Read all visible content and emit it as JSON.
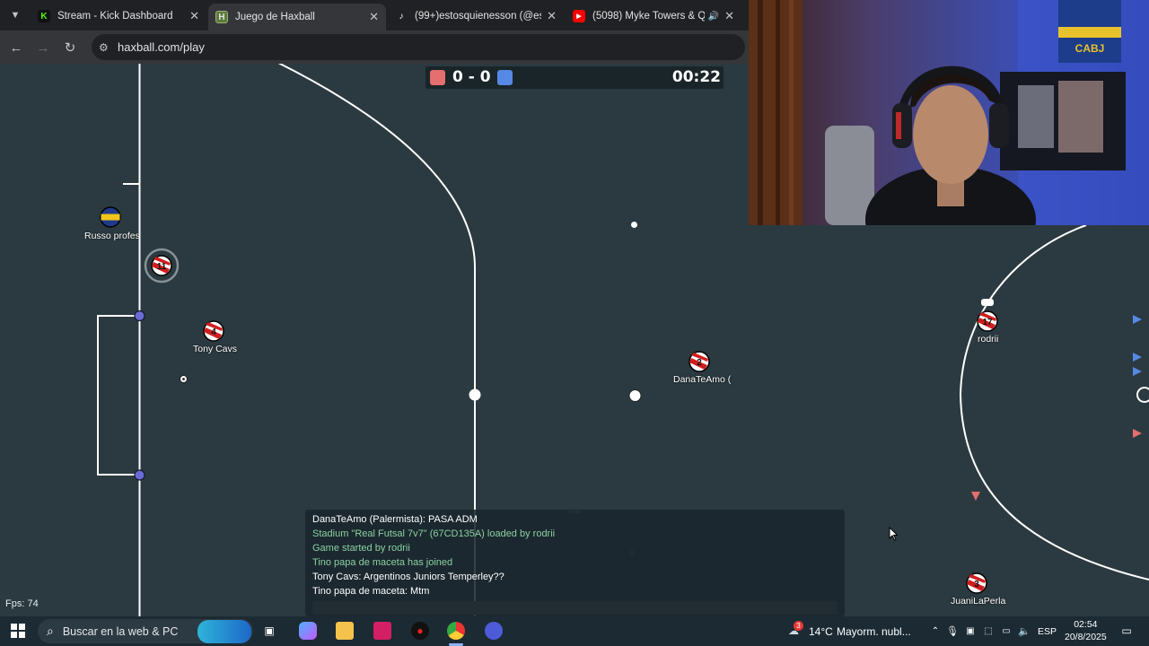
{
  "browser": {
    "tabs": [
      {
        "label": "Stream - Kick Dashboard",
        "active": false
      },
      {
        "label": "Juego de Haxball",
        "active": true
      },
      {
        "label": "(99+)estosquienesson (@estosqu",
        "active": false
      },
      {
        "label": "(5098) Myke Towers & Quevedo",
        "active": false
      }
    ],
    "url": "haxball.com/play"
  },
  "game": {
    "red_score": "0",
    "blue_score": "0",
    "score_text": "0 - 0",
    "time": "00:22",
    "colors": {
      "field": "#2b3a40",
      "red": "#e56e6e",
      "blue": "#5689e5",
      "lines": "#ffffff"
    },
    "players": [
      {
        "name": "Russo profesi",
        "number": ""
      },
      {
        "name": "",
        "number": "11"
      },
      {
        "name": "Tony Cavs",
        "number": "4"
      },
      {
        "name": "DanaTeAmo (",
        "number": "2"
      },
      {
        "name": "rodrii",
        "number": "17"
      },
      {
        "name": "JuaniLaPerla",
        "number": "3"
      }
    ],
    "chat": [
      {
        "text": "DanaTeAmo (Palermista): PASA ADM",
        "kind": "msg"
      },
      {
        "text": "Stadium \"Real Futsal 7v7\" (67CD135A) loaded by rodrii",
        "kind": "sys"
      },
      {
        "text": "Game started by rodrii",
        "kind": "sys"
      },
      {
        "text": "Tino papa de maceta has joined",
        "kind": "sys"
      },
      {
        "text": "Tony Cavs: Argentinos Juniors Temperley??",
        "kind": "msg"
      },
      {
        "text": "Tino papa de maceta: Mtm",
        "kind": "msg"
      }
    ],
    "fps": "Fps: 74"
  },
  "webcam": {
    "shirt_text": "CABJ"
  },
  "taskbar": {
    "search_label": "Buscar en la web & PC",
    "weather_temp": "14°C",
    "weather_desc": "Mayorm. nubl...",
    "weather_badge": "3",
    "language": "ESP",
    "time": "02:54",
    "date": "20/8/2025"
  }
}
